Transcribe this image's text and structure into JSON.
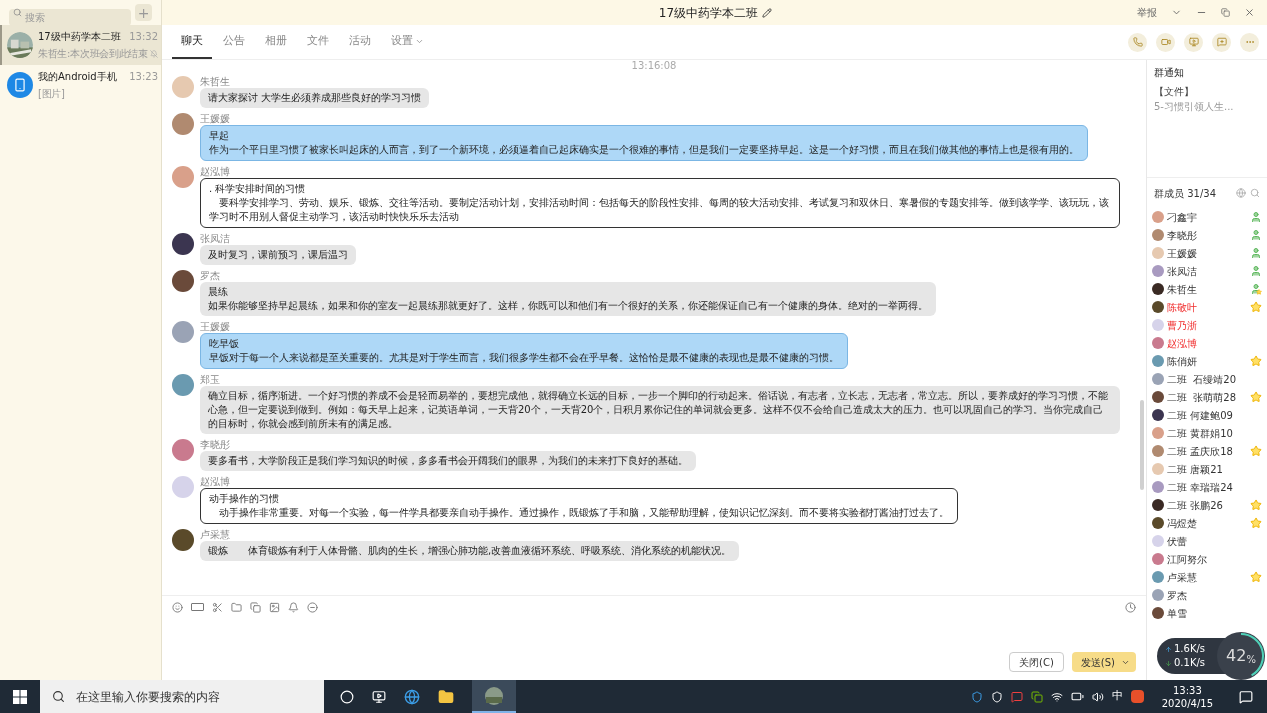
{
  "sidebar": {
    "search": {
      "placeholder": "搜索"
    },
    "add_button": "+",
    "conversations": [
      {
        "name": "17级中药学本二班",
        "time": "13:32",
        "preview": "朱哲生:本次班会到此结束",
        "selected": true,
        "muted": true,
        "kind": "group"
      },
      {
        "name": "我的Android手机",
        "time": "13:23",
        "preview": "[图片]",
        "selected": false,
        "muted": false,
        "kind": "device"
      }
    ]
  },
  "window": {
    "title": "17级中药学本二班",
    "report": "举报"
  },
  "tabs": [
    {
      "label": "聊天",
      "selected": true
    },
    {
      "label": "公告",
      "selected": false
    },
    {
      "label": "相册",
      "selected": false
    },
    {
      "label": "文件",
      "selected": false
    },
    {
      "label": "活动",
      "selected": false
    },
    {
      "label": "设置",
      "selected": false,
      "dropdown": true
    }
  ],
  "chat": {
    "timestamp": "13:16:08",
    "messages": [
      {
        "sender": "朱哲生",
        "kind": "gray",
        "lines": [
          "请大家探讨 大学生必须养成那些良好的学习习惯"
        ]
      },
      {
        "sender": "王媛媛",
        "kind": "blue",
        "lines": [
          "早起",
          "作为一个平日里习惯了被家长叫起床的人而言，到了一个新环境，必须逼着自己起床确实是一个很难的事情，但是我们一定要坚持早起。这是一个好习惯，而且在我们做其他的事情上也是很有用的。"
        ]
      },
      {
        "sender": "赵泓博",
        "kind": "outlined",
        "lines": [
          ". 科学安排时间的习惯",
          "　要科学安排学习、劳动、娱乐、锻炼、交往等活动。要制定活动计划，安排活动时间：包括每天的阶段性安排、每周的较大活动安排、考试复习和双休日、寒暑假的专题安排等。做到该学学、该玩玩，该学习时不用别人督促主动学习，该活动时快快乐乐去活动"
        ]
      },
      {
        "sender": "张凤洁",
        "kind": "gray",
        "lines": [
          "及时复习，课前预习，课后温习"
        ]
      },
      {
        "sender": "罗杰",
        "kind": "gray",
        "lines": [
          "晨练",
          "如果你能够坚持早起晨练，如果和你的室友一起晨练那就更好了。这样，你既可以和他们有一个很好的关系，你还能保证自己有一个健康的身体。绝对的一举两得。"
        ]
      },
      {
        "sender": "王媛媛",
        "kind": "blue",
        "lines": [
          "吃早饭",
          "早饭对于每一个人来说都是至关重要的。尤其是对于学生而言，我们很多学生都不会在乎早餐。这恰恰是最不健康的表现也是最不健康的习惯。"
        ]
      },
      {
        "sender": "郑玉",
        "kind": "gray",
        "lines": [
          "确立目标，循序渐进。一个好习惯的养成不会是轻而易举的，要想完成他，就得确立长远的目标，一步一个脚印的行动起来。俗话说，有志者，立长志，无志者，常立志。所以，要养成好的学习习惯，不能心急，但一定要说到做到。例如：每天早上起来，记英语单词，一天背20个，一天背20个，日积月累你记住的单词就会更多。这样不仅不会给自己造成太大的压力。也可以巩固自己的学习。当你完成自己的目标时，你就会感到前所未有的满足感。"
        ]
      },
      {
        "sender": "李晓彤",
        "kind": "gray",
        "lines": [
          "要多看书，大学阶段正是我们学习知识的时候，多多看书会开阔我们的眼界，为我们的未来打下良好的基础。"
        ]
      },
      {
        "sender": "赵泓博",
        "kind": "outlined",
        "lines": [
          "动手操作的习惯",
          "　动手操作非常重要。对每一个实验，每一件学具都要亲自动手操作。通过操作，既锻炼了手和脑，又能帮助理解，使知识记忆深刻。而不要将实验都打酱油打过去了。"
        ]
      },
      {
        "sender": "卢采慧",
        "kind": "gray",
        "lines": [
          "锻炼　　体育锻炼有利于人体骨骼、肌肉的生长，增强心肺功能,改善血液循环系统、呼吸系统、消化系统的机能状况。"
        ]
      }
    ]
  },
  "composer": {
    "close_button": "关闭(C)",
    "send_button": "发送(S)"
  },
  "notice": {
    "title": "群通知",
    "tag": "【文件】",
    "text": "5-习惯引领人生..."
  },
  "members": {
    "title": "群成员 31/34",
    "list": [
      {
        "name": "刁鑫宇",
        "kind": "admin",
        "highlight": false
      },
      {
        "name": "李晓彤",
        "kind": "admin",
        "highlight": false
      },
      {
        "name": "王媛媛",
        "kind": "admin",
        "highlight": false
      },
      {
        "name": "张凤洁",
        "kind": "admin",
        "highlight": false
      },
      {
        "name": "朱哲生",
        "kind": "owner",
        "highlight": false
      },
      {
        "name": "陈敬叶",
        "kind": "star",
        "highlight": true
      },
      {
        "name": "曹乃浙",
        "kind": "plain",
        "highlight": true
      },
      {
        "name": "赵泓博",
        "kind": "plain",
        "highlight": true
      },
      {
        "name": "陈俏妍",
        "kind": "star",
        "highlight": false
      },
      {
        "name": "二班  石缦靖20",
        "kind": "plain",
        "highlight": false
      },
      {
        "name": "二班  张萌萌28",
        "kind": "star",
        "highlight": false
      },
      {
        "name": "二班 何建鲍09",
        "kind": "plain",
        "highlight": false
      },
      {
        "name": "二班 黄群娟10",
        "kind": "plain",
        "highlight": false
      },
      {
        "name": "二班 孟庆欣18",
        "kind": "star",
        "highlight": false
      },
      {
        "name": "二班 唐颖21",
        "kind": "plain",
        "highlight": false
      },
      {
        "name": "二班 幸瑞瑞24",
        "kind": "plain",
        "highlight": false
      },
      {
        "name": "二班 张鹏26",
        "kind": "star",
        "highlight": false
      },
      {
        "name": "冯煜楚",
        "kind": "star",
        "highlight": false
      },
      {
        "name": "伏蕾",
        "kind": "plain",
        "highlight": false
      },
      {
        "name": "江阿努尔",
        "kind": "plain",
        "highlight": false
      },
      {
        "name": "卢采慧",
        "kind": "star",
        "highlight": false
      },
      {
        "name": "罗杰",
        "kind": "plain",
        "highlight": false
      },
      {
        "name": "单雪",
        "kind": "plain",
        "highlight": false
      }
    ]
  },
  "net_widget": {
    "upload": "1.6K/s",
    "download": "0.1K/s",
    "percent": "42",
    "unit": "%",
    "level": 0.42
  },
  "taskbar": {
    "search_placeholder": "在这里输入你要搜索的内容",
    "ime": "中",
    "time": "13:33",
    "date": "2020/4/15"
  }
}
